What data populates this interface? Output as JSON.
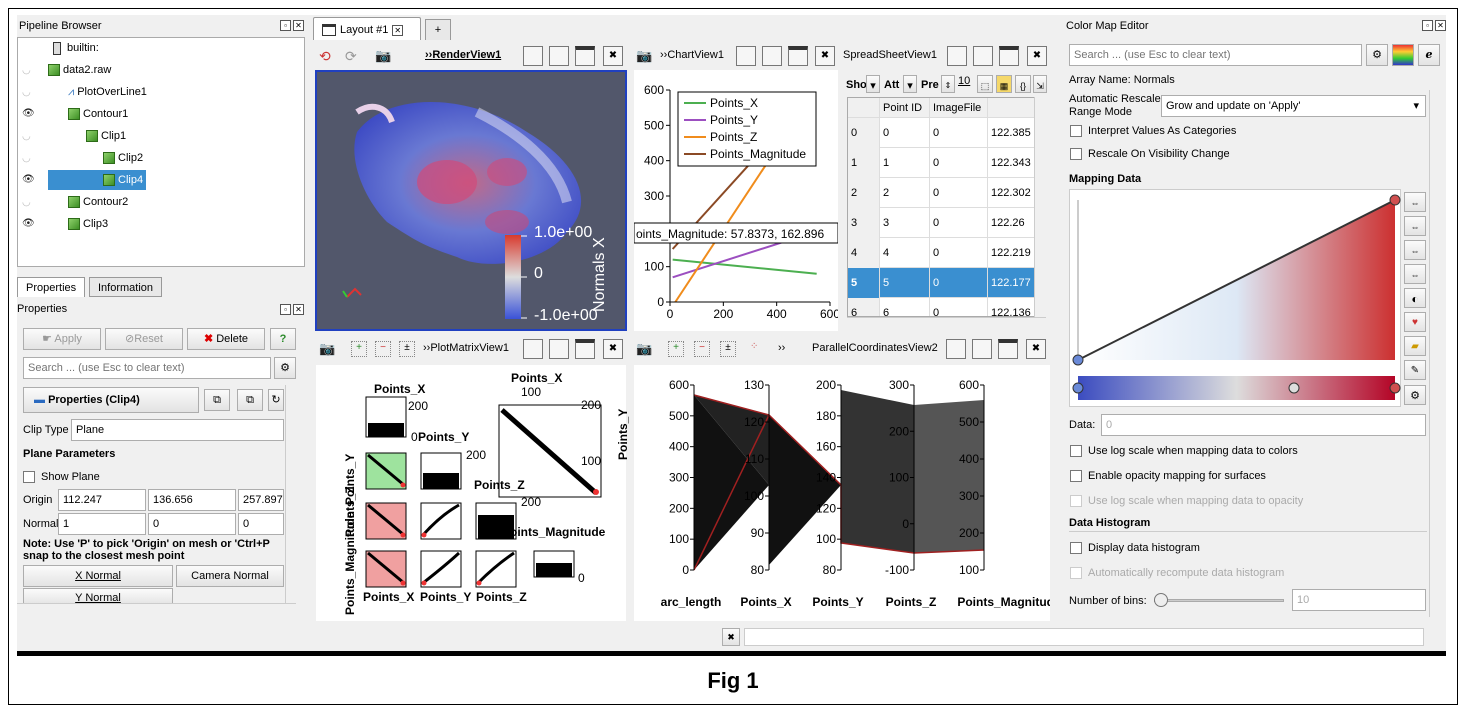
{
  "pipeline": {
    "title": "Pipeline Browser",
    "items": [
      {
        "label": "builtin:",
        "visible": null
      },
      {
        "label": "data2.raw",
        "visible": false
      },
      {
        "label": "PlotOverLine1",
        "visible": false
      },
      {
        "label": "Contour1",
        "visible": true
      },
      {
        "label": "Clip1",
        "visible": false
      },
      {
        "label": "Clip2",
        "visible": false
      },
      {
        "label": "Clip4",
        "visible": true
      },
      {
        "label": "Contour2",
        "visible": false
      },
      {
        "label": "Clip3",
        "visible": true
      }
    ]
  },
  "props": {
    "tab_properties": "Properties",
    "tab_information": "Information",
    "panel_title": "Properties",
    "apply": "Apply",
    "reset": "Reset",
    "delete": "Delete",
    "help": "?",
    "search_placeholder": "Search ... (use Esc to clear text)",
    "section": "Properties (Clip4)",
    "clip_type_label": "Clip Type",
    "clip_type_value": "Plane",
    "plane_params": "Plane Parameters",
    "show_plane": "Show Plane",
    "origin_label": "Origin",
    "origin": [
      "112.247",
      "136.656",
      "257.897"
    ],
    "normal_label": "Normal",
    "normal": [
      "1",
      "0",
      "0"
    ],
    "note": "Note: Use 'P' to pick 'Origin' on mesh or 'Ctrl+P' to snap to the closest mesh point",
    "note_line1": "Note: Use 'P' to pick 'Origin' on mesh or 'Ctrl+P",
    "note_line2": "snap to the closest mesh point",
    "x_normal": "X Normal",
    "camera_normal": "Camera Normal",
    "y_normal": "Y Normal"
  },
  "layout": {
    "tab": "Layout #1",
    "add": "+",
    "render_view": "RenderView1",
    "chart_view": "ChartView1",
    "spreadsheet_view": "SpreadSheetView1",
    "plotmatrix_view": "PlotMatrixView1",
    "parallel_view": "ParallelCoordinatesView2"
  },
  "render": {
    "colorbar_title": "Normals X",
    "colorbar_max": "1.0e+00",
    "colorbar_mid": "0",
    "colorbar_min": "-1.0e+00"
  },
  "spreadsheet": {
    "show_label": "Sho",
    "attr_label": "Att",
    "prec_label": "Pre",
    "prec_value": "10",
    "columns": [
      "",
      "Point ID",
      "ImageFile",
      ""
    ],
    "rows": [
      [
        "0",
        "0",
        "0",
        "122.385"
      ],
      [
        "1",
        "1",
        "0",
        "122.343"
      ],
      [
        "2",
        "2",
        "0",
        "122.302"
      ],
      [
        "3",
        "3",
        "0",
        "122.26"
      ],
      [
        "4",
        "4",
        "0",
        "122.219"
      ],
      [
        "5",
        "5",
        "0",
        "122.177"
      ],
      [
        "6",
        "6",
        "0",
        "122.136"
      ]
    ],
    "selected_row": 5
  },
  "chart_data": [
    {
      "type": "line",
      "title": "",
      "series": [
        {
          "name": "Points_X",
          "color": "#4caf50",
          "x": [
            10,
            550
          ],
          "y": [
            120,
            80
          ]
        },
        {
          "name": "Points_Y",
          "color": "#9c4fc0",
          "x": [
            10,
            550
          ],
          "y": [
            70,
            200
          ]
        },
        {
          "name": "Points_Z",
          "color": "#f08c1c",
          "x": [
            20,
            370
          ],
          "y": [
            0,
            400
          ]
        },
        {
          "name": "Points_Magnitude",
          "color": "#8b4a25",
          "x": [
            10,
            310
          ],
          "y": [
            150,
            400
          ]
        }
      ],
      "xticks": [
        "0",
        "200",
        "400",
        "600"
      ],
      "yticks": [
        "0",
        "100",
        "200",
        "300",
        "400",
        "500",
        "600"
      ],
      "xlim": [
        0,
        600
      ],
      "ylim": [
        0,
        600
      ],
      "tooltip": "Points_Magnitude: 57.8373, 162.896",
      "tooltip_visible": "oints_Magnitude: 57.8373, 162.896",
      "legend": "top-right"
    },
    {
      "type": "parallel",
      "axes": [
        {
          "name": "arc_length",
          "ticks": [
            "600",
            "500",
            "400",
            "300",
            "200",
            "100",
            "0"
          ]
        },
        {
          "name": "Points_X",
          "ticks": [
            "130",
            "120",
            "110",
            "100",
            "90",
            "80"
          ]
        },
        {
          "name": "Points_Y",
          "ticks": [
            "200",
            "180",
            "160",
            "140",
            "120",
            "100",
            "80"
          ]
        },
        {
          "name": "Points_Z",
          "ticks": [
            "300",
            "200",
            "100",
            "0",
            "-100"
          ]
        },
        {
          "name": "Points_Magnitude",
          "ticks": [
            "600",
            "500",
            "400",
            "300",
            "200",
            "100"
          ]
        }
      ]
    }
  ],
  "plotmatrix": {
    "labels": [
      "Points_X",
      "Points_Y",
      "Points_Z",
      "Points_Magnitude"
    ],
    "tick_200": "200",
    "tick_100": "100",
    "tick_0": "0"
  },
  "colormap": {
    "title": "Color Map Editor",
    "search_placeholder": "Search ... (use Esc to clear text)",
    "array_name": "Array Name: Normals",
    "auto_rescale_label_1": "Automatic Rescale",
    "auto_rescale_label_2": "Range Mode",
    "auto_rescale_value": "Grow and update on 'Apply'",
    "interpret": "Interpret Values As Categories",
    "rescale_vis": "Rescale On Visibility Change",
    "mapping_data": "Mapping Data",
    "data_label": "Data:",
    "data_value": "0",
    "log_scale": "Use log scale when mapping data to colors",
    "opacity_mapping": "Enable opacity mapping for surfaces",
    "log_opacity": "Use log scale when mapping data to opacity",
    "histogram": "Data Histogram",
    "display_hist": "Display data histogram",
    "auto_recompute": "Automatically recompute data histogram",
    "bins_label": "Number of bins:",
    "bins_value": "10"
  },
  "figure": {
    "caption": "Fig 1"
  }
}
